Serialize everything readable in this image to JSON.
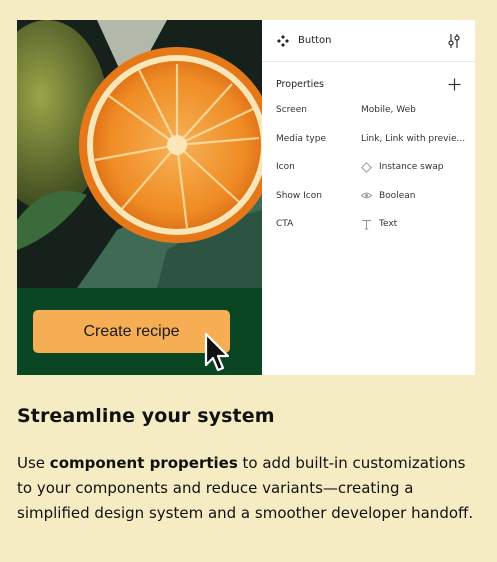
{
  "preview": {
    "cta_label": "Create recipe"
  },
  "panel": {
    "title": "Button",
    "section_title": "Properties",
    "rows": [
      {
        "label": "Screen",
        "value": "Mobile, Web"
      },
      {
        "label": "Media type",
        "value": "Link, Link with previe..."
      },
      {
        "label": "Icon",
        "value": "Instance swap",
        "icon": "diamond-icon"
      },
      {
        "label": "Show Icon",
        "value": "Boolean",
        "icon": "eye-icon"
      },
      {
        "label": "CTA",
        "value": "Text",
        "icon": "text-t-icon"
      }
    ]
  },
  "content": {
    "headline": "Streamline your system",
    "desc_pre": "Use ",
    "desc_bold": "component properties",
    "desc_post": " to add built-in customizations to your components and reduce variants—creating a simplified design system and a smoother developer handoff."
  },
  "colors": {
    "background": "#f5ecc3",
    "cta_button": "#f6ae55",
    "green_band": "#0b4624"
  }
}
